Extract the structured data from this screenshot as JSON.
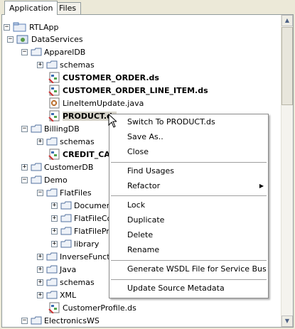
{
  "tabs": [
    {
      "label": "Application"
    },
    {
      "label": "Files"
    }
  ],
  "tree": {
    "rtl_app": "RTLApp",
    "data_services": "DataServices",
    "apparel_db": "ApparelDB",
    "apparel_schemas": "schemas",
    "customer_order": "CUSTOMER_ORDER.ds",
    "customer_order_line_item": "CUSTOMER_ORDER_LINE_ITEM.ds",
    "line_item_update": "LineItemUpdate.java",
    "product": "PRODUCT.ds",
    "billing_db": "BillingDB",
    "billing_schemas": "schemas",
    "credit_card": "CREDIT_CAR",
    "customer_db": "CustomerDB",
    "demo": "Demo",
    "flat_files": "FlatFiles",
    "document": "Document",
    "flat_file_co": "FlatFileCo",
    "flat_file_pro": "FlatFilePro",
    "library": "library",
    "inverse_function": "InverseFunctio",
    "java": "Java",
    "demo_schemas": "schemas",
    "xml": "XML",
    "customer_profile": "CustomerProfile.ds",
    "electronics_ws": "ElectronicsWS"
  },
  "context_menu": {
    "switch_to": "Switch To PRODUCT.ds",
    "save_as": "Save As..",
    "close": "Close",
    "find_usages": "Find Usages",
    "refactor": "Refactor",
    "lock": "Lock",
    "duplicate": "Duplicate",
    "delete": "Delete",
    "rename": "Rename",
    "generate_wsdl": "Generate WSDL File for Service Bus",
    "update_source_metadata": "Update Source Metadata"
  }
}
